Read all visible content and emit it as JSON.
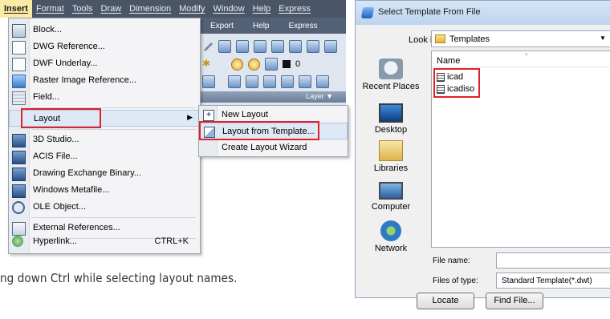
{
  "menubar": {
    "items": [
      "Insert",
      "Format",
      "Tools",
      "Draw",
      "Dimension",
      "Modify",
      "Window",
      "Help",
      "Express"
    ]
  },
  "ribbon": {
    "tabs": [
      "Export",
      "Help",
      "Express"
    ],
    "layer_value": "0",
    "panel_label": "Layer ▼"
  },
  "insert_menu": {
    "items": [
      {
        "label": "Block...",
        "icon": "block-icon"
      },
      {
        "label": "DWG Reference...",
        "icon": "dwg-reference-icon"
      },
      {
        "label": "DWF Underlay...",
        "icon": "dwf-underlay-icon"
      },
      {
        "label": "Raster Image Reference...",
        "icon": "raster-image-icon"
      },
      {
        "label": "Field...",
        "icon": "field-icon"
      },
      {
        "label": "Layout",
        "icon": "",
        "submenu_arrow": "▶"
      },
      {
        "label": "3D Studio...",
        "icon": "3d-studio-icon"
      },
      {
        "label": "ACIS File...",
        "icon": "acis-file-icon"
      },
      {
        "label": "Drawing Exchange Binary...",
        "icon": "dxb-icon"
      },
      {
        "label": "Windows Metafile...",
        "icon": "wmf-icon"
      },
      {
        "label": "OLE Object...",
        "icon": "ole-object-icon"
      },
      {
        "label": "External References...",
        "icon": "external-references-icon"
      },
      {
        "label": "Hyperlink...",
        "icon": "hyperlink-icon",
        "shortcut": "CTRL+K"
      }
    ]
  },
  "layout_submenu": {
    "items": [
      {
        "label": "New Layout",
        "icon": "new-layout-icon"
      },
      {
        "label": "Layout from Template...",
        "icon": "layout-template-icon"
      },
      {
        "label": "Create Layout Wizard",
        "icon": ""
      }
    ]
  },
  "caption": "ng down Ctrl while selecting layout names.",
  "dialog": {
    "title": "Select Template From File",
    "look_in_label": "Look in:",
    "look_in_value": "Templates",
    "places": [
      "Recent Places",
      "Desktop",
      "Libraries",
      "Computer",
      "Network"
    ],
    "column_name": "Name",
    "files": [
      "icad",
      "icadiso"
    ],
    "file_name_label": "File name:",
    "file_name_value": "",
    "files_of_type_label": "Files of type:",
    "files_of_type_value": "Standard Template(*.dwt)",
    "locate_button": "Locate",
    "find_file_button": "Find File..."
  },
  "colors": {
    "highlight_box": "#e0202a",
    "menubar_bg": "#4a5668",
    "active_menu_bg": "#fbeaa6",
    "dialog_title_bg": "#bcd3ee"
  }
}
